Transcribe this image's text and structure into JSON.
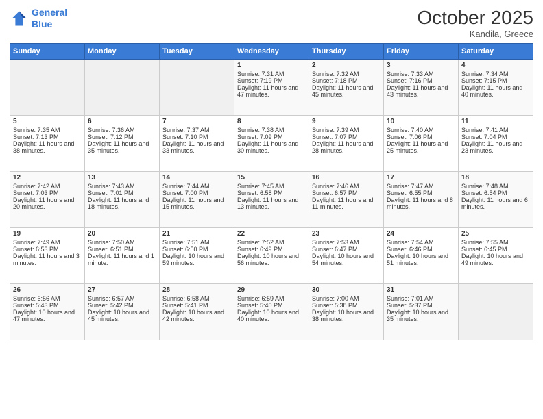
{
  "header": {
    "logo_line1": "General",
    "logo_line2": "Blue",
    "month": "October 2025",
    "location": "Kandila, Greece"
  },
  "days_header": [
    "Sunday",
    "Monday",
    "Tuesday",
    "Wednesday",
    "Thursday",
    "Friday",
    "Saturday"
  ],
  "weeks": [
    [
      {
        "day": "",
        "info": ""
      },
      {
        "day": "",
        "info": ""
      },
      {
        "day": "",
        "info": ""
      },
      {
        "day": "1",
        "info": "Sunrise: 7:31 AM\nSunset: 7:19 PM\nDaylight: 11 hours and 47 minutes."
      },
      {
        "day": "2",
        "info": "Sunrise: 7:32 AM\nSunset: 7:18 PM\nDaylight: 11 hours and 45 minutes."
      },
      {
        "day": "3",
        "info": "Sunrise: 7:33 AM\nSunset: 7:16 PM\nDaylight: 11 hours and 43 minutes."
      },
      {
        "day": "4",
        "info": "Sunrise: 7:34 AM\nSunset: 7:15 PM\nDaylight: 11 hours and 40 minutes."
      }
    ],
    [
      {
        "day": "5",
        "info": "Sunrise: 7:35 AM\nSunset: 7:13 PM\nDaylight: 11 hours and 38 minutes."
      },
      {
        "day": "6",
        "info": "Sunrise: 7:36 AM\nSunset: 7:12 PM\nDaylight: 11 hours and 35 minutes."
      },
      {
        "day": "7",
        "info": "Sunrise: 7:37 AM\nSunset: 7:10 PM\nDaylight: 11 hours and 33 minutes."
      },
      {
        "day": "8",
        "info": "Sunrise: 7:38 AM\nSunset: 7:09 PM\nDaylight: 11 hours and 30 minutes."
      },
      {
        "day": "9",
        "info": "Sunrise: 7:39 AM\nSunset: 7:07 PM\nDaylight: 11 hours and 28 minutes."
      },
      {
        "day": "10",
        "info": "Sunrise: 7:40 AM\nSunset: 7:06 PM\nDaylight: 11 hours and 25 minutes."
      },
      {
        "day": "11",
        "info": "Sunrise: 7:41 AM\nSunset: 7:04 PM\nDaylight: 11 hours and 23 minutes."
      }
    ],
    [
      {
        "day": "12",
        "info": "Sunrise: 7:42 AM\nSunset: 7:03 PM\nDaylight: 11 hours and 20 minutes."
      },
      {
        "day": "13",
        "info": "Sunrise: 7:43 AM\nSunset: 7:01 PM\nDaylight: 11 hours and 18 minutes."
      },
      {
        "day": "14",
        "info": "Sunrise: 7:44 AM\nSunset: 7:00 PM\nDaylight: 11 hours and 15 minutes."
      },
      {
        "day": "15",
        "info": "Sunrise: 7:45 AM\nSunset: 6:58 PM\nDaylight: 11 hours and 13 minutes."
      },
      {
        "day": "16",
        "info": "Sunrise: 7:46 AM\nSunset: 6:57 PM\nDaylight: 11 hours and 11 minutes."
      },
      {
        "day": "17",
        "info": "Sunrise: 7:47 AM\nSunset: 6:55 PM\nDaylight: 11 hours and 8 minutes."
      },
      {
        "day": "18",
        "info": "Sunrise: 7:48 AM\nSunset: 6:54 PM\nDaylight: 11 hours and 6 minutes."
      }
    ],
    [
      {
        "day": "19",
        "info": "Sunrise: 7:49 AM\nSunset: 6:53 PM\nDaylight: 11 hours and 3 minutes."
      },
      {
        "day": "20",
        "info": "Sunrise: 7:50 AM\nSunset: 6:51 PM\nDaylight: 11 hours and 1 minute."
      },
      {
        "day": "21",
        "info": "Sunrise: 7:51 AM\nSunset: 6:50 PM\nDaylight: 10 hours and 59 minutes."
      },
      {
        "day": "22",
        "info": "Sunrise: 7:52 AM\nSunset: 6:49 PM\nDaylight: 10 hours and 56 minutes."
      },
      {
        "day": "23",
        "info": "Sunrise: 7:53 AM\nSunset: 6:47 PM\nDaylight: 10 hours and 54 minutes."
      },
      {
        "day": "24",
        "info": "Sunrise: 7:54 AM\nSunset: 6:46 PM\nDaylight: 10 hours and 51 minutes."
      },
      {
        "day": "25",
        "info": "Sunrise: 7:55 AM\nSunset: 6:45 PM\nDaylight: 10 hours and 49 minutes."
      }
    ],
    [
      {
        "day": "26",
        "info": "Sunrise: 6:56 AM\nSunset: 5:43 PM\nDaylight: 10 hours and 47 minutes."
      },
      {
        "day": "27",
        "info": "Sunrise: 6:57 AM\nSunset: 5:42 PM\nDaylight: 10 hours and 45 minutes."
      },
      {
        "day": "28",
        "info": "Sunrise: 6:58 AM\nSunset: 5:41 PM\nDaylight: 10 hours and 42 minutes."
      },
      {
        "day": "29",
        "info": "Sunrise: 6:59 AM\nSunset: 5:40 PM\nDaylight: 10 hours and 40 minutes."
      },
      {
        "day": "30",
        "info": "Sunrise: 7:00 AM\nSunset: 5:38 PM\nDaylight: 10 hours and 38 minutes."
      },
      {
        "day": "31",
        "info": "Sunrise: 7:01 AM\nSunset: 5:37 PM\nDaylight: 10 hours and 35 minutes."
      },
      {
        "day": "",
        "info": ""
      }
    ]
  ]
}
